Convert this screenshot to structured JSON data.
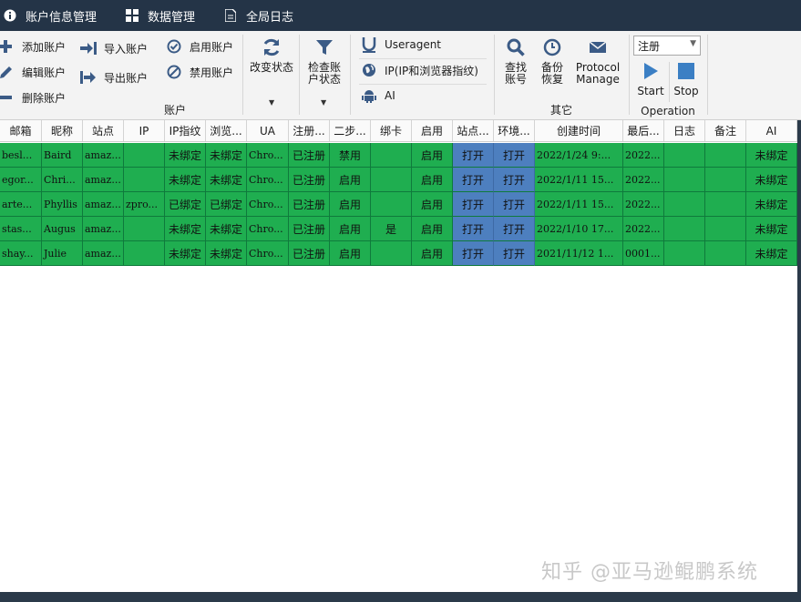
{
  "tabs": [
    {
      "label": "账户信息管理",
      "icon": "info-icon"
    },
    {
      "label": "数据管理",
      "icon": "grid-icon"
    },
    {
      "label": "全局日志",
      "icon": "document-icon"
    }
  ],
  "ribbon": {
    "account": {
      "add": "添加账户",
      "edit": "编辑账户",
      "delete": "删除账户",
      "import": "导入账户",
      "export": "导出账户",
      "enable": "启用账户",
      "disable": "禁用账户",
      "change_status": "改变状态",
      "check_status": "检查账户状态",
      "label": "账户"
    },
    "config": {
      "useragent": "Useragent",
      "ip": "IP(IP和浏览器指纹)",
      "ai": "AI"
    },
    "other": {
      "find": "查找账号",
      "backup": "备份恢复",
      "protocol": "Protocol Manage",
      "label": "其它"
    },
    "operation": {
      "dropdown_value": "注册",
      "start": "Start",
      "stop": "Stop",
      "label": "Operation"
    }
  },
  "colors": {
    "green": "#1fae50",
    "blue": "#4d7fbf",
    "topbar": "#243447"
  },
  "table": {
    "headers": [
      "邮箱",
      "昵称",
      "站点",
      "IP",
      "IP指纹",
      "浏览...",
      "UA",
      "注册...",
      "二步...",
      "绑卡",
      "启用",
      "站点...",
      "环境...",
      "创建时间",
      "最后...",
      "日志",
      "备注",
      "AI"
    ],
    "rows": [
      [
        "besl...",
        "Baird",
        "amaz...",
        "",
        "未绑定",
        "未绑定",
        "Chro...",
        "已注册",
        "禁用",
        "",
        "启用",
        "打开",
        "打开",
        "2022/1/24 9:...",
        "2022...",
        "",
        "",
        "未绑定"
      ],
      [
        "egor...",
        "Chri...",
        "amaz...",
        "",
        "未绑定",
        "未绑定",
        "Chro...",
        "已注册",
        "启用",
        "",
        "启用",
        "打开",
        "打开",
        "2022/1/11 15...",
        "2022...",
        "",
        "",
        "未绑定"
      ],
      [
        "arte...",
        "Phyllis",
        "amaz...",
        "zpro...",
        "已绑定",
        "已绑定",
        "Chro...",
        "已注册",
        "启用",
        "",
        "启用",
        "打开",
        "打开",
        "2022/1/11 15...",
        "2022...",
        "",
        "",
        "未绑定"
      ],
      [
        "stas...",
        "Augus",
        "amaz...",
        "",
        "未绑定",
        "未绑定",
        "Chro...",
        "已注册",
        "启用",
        "是",
        "启用",
        "打开",
        "打开",
        "2022/1/10 17...",
        "2022...",
        "",
        "",
        "未绑定"
      ],
      [
        "shay...",
        "Julie",
        "amaz...",
        "",
        "未绑定",
        "未绑定",
        "Chro...",
        "已注册",
        "启用",
        "",
        "启用",
        "打开",
        "打开",
        "2021/11/12 1...",
        "0001...",
        "",
        "",
        "未绑定"
      ]
    ]
  },
  "watermark": "知乎 @亚马逊鲲鹏系统"
}
